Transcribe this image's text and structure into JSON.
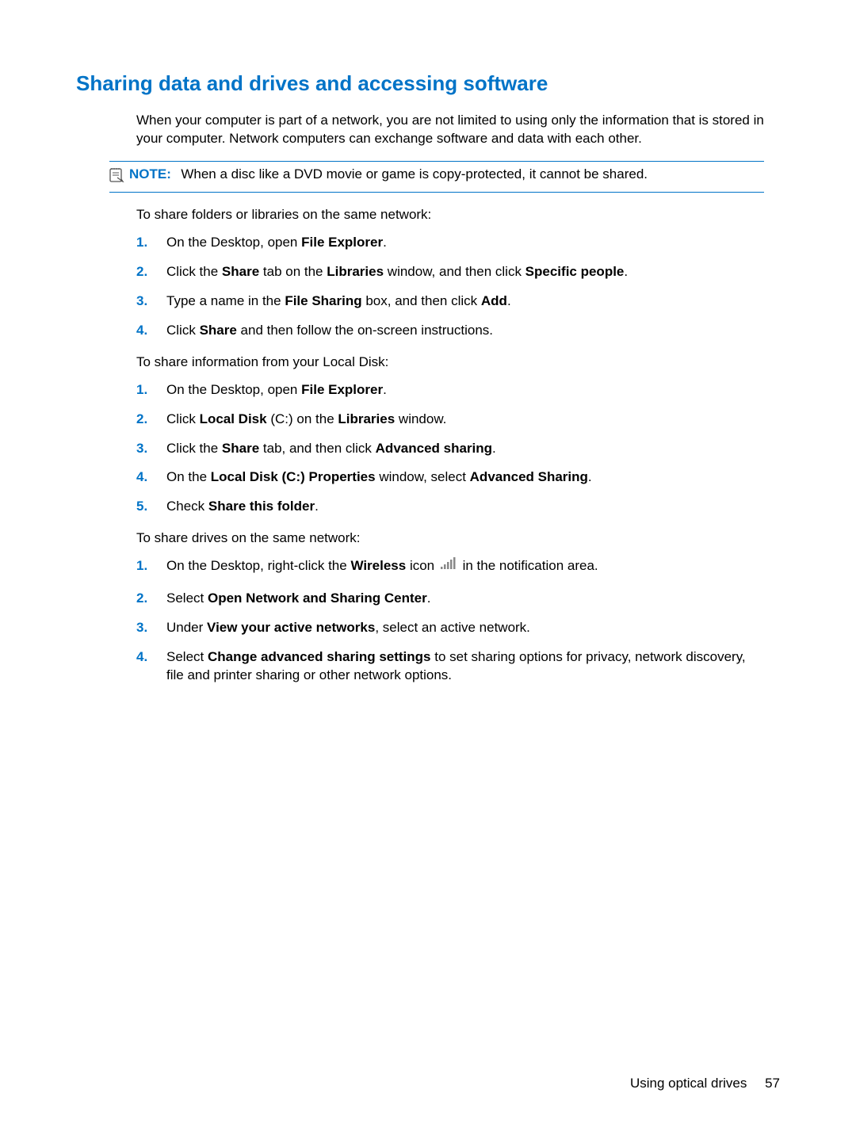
{
  "heading": "Sharing data and drives and accessing software",
  "intro": "When your computer is part of a network, you are not limited to using only the information that is stored in your computer. Network computers can exchange software and data with each other.",
  "note": {
    "label": "NOTE:",
    "text": "When a disc like a DVD movie or game is copy-protected, it cannot be shared."
  },
  "sectionA_intro": "To share folders or libraries on the same network:",
  "listA": {
    "n1": "1.",
    "t1_pre": "On the Desktop, open ",
    "t1_b": "File Explorer",
    "t1_post": ".",
    "n2": "2.",
    "t2_pre": "Click the ",
    "t2_b1": "Share",
    "t2_mid": " tab on the ",
    "t2_b2": "Libraries",
    "t2_mid2": " window, and then click ",
    "t2_b3": "Specific people",
    "t2_post": ".",
    "n3": "3.",
    "t3_pre": "Type a name in the ",
    "t3_b1": "File Sharing",
    "t3_mid": " box, and then click ",
    "t3_b2": "Add",
    "t3_post": ".",
    "n4": "4.",
    "t4_pre": "Click ",
    "t4_b": "Share",
    "t4_post": " and then follow the on-screen instructions."
  },
  "sectionB_intro": "To share information from your Local Disk:",
  "listB": {
    "n1": "1.",
    "t1_pre": "On the Desktop, open ",
    "t1_b": "File Explorer",
    "t1_post": ".",
    "n2": "2.",
    "t2_pre": "Click ",
    "t2_b1": "Local Disk",
    "t2_mid": " (C:) on the ",
    "t2_b2": "Libraries",
    "t2_post": " window.",
    "n3": "3.",
    "t3_pre": "Click the ",
    "t3_b1": "Share",
    "t3_mid": " tab, and then click ",
    "t3_b2": "Advanced sharing",
    "t3_post": ".",
    "n4": "4.",
    "t4_pre": "On the ",
    "t4_b1": "Local Disk (C:) Properties",
    "t4_mid": " window, select ",
    "t4_b2": "Advanced Sharing",
    "t4_post": ".",
    "n5": "5.",
    "t5_pre": "Check ",
    "t5_b": "Share this folder",
    "t5_post": "."
  },
  "sectionC_intro": "To share drives on the same network:",
  "listC": {
    "n1": "1.",
    "t1_pre": "On the Desktop, right-click the ",
    "t1_b": "Wireless",
    "t1_mid": " icon ",
    "t1_post": " in the notification area.",
    "n2": "2.",
    "t2_pre": "Select ",
    "t2_b": "Open Network and Sharing Center",
    "t2_post": ".",
    "n3": "3.",
    "t3_pre": "Under ",
    "t3_b": "View your active networks",
    "t3_post": ", select an active network.",
    "n4": "4.",
    "t4_pre": "Select ",
    "t4_b": "Change advanced sharing settings",
    "t4_post": " to set sharing options for privacy, network discovery, file and printer sharing or other network options."
  },
  "footer": {
    "section": "Using optical drives",
    "page": "57"
  }
}
